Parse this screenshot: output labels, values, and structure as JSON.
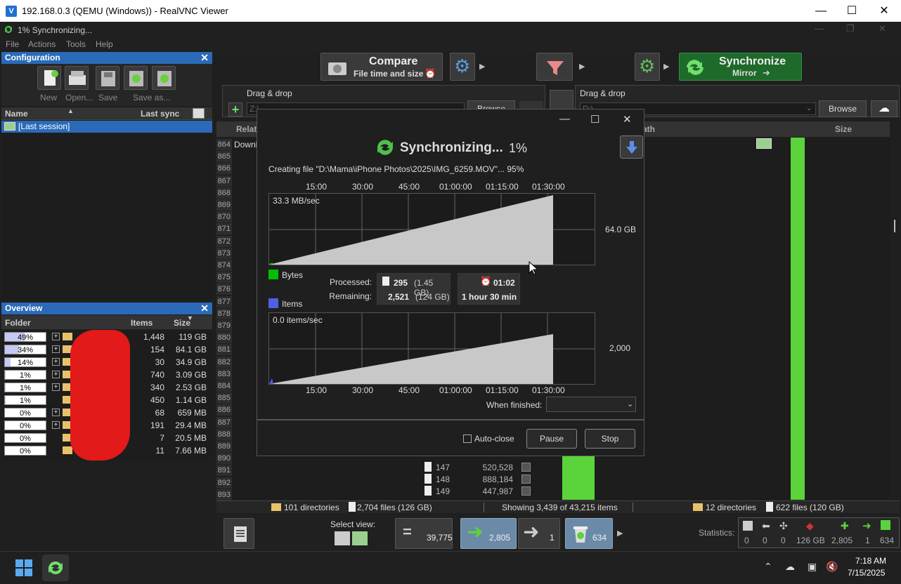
{
  "vnc": {
    "title": "192.168.0.3 (QEMU (Windows)) - RealVNC Viewer",
    "icon": "realvnc-icon",
    "minimize": "—",
    "maximize": "☐",
    "close": "✕"
  },
  "app": {
    "title": "1% Synchronizing...",
    "menu": [
      "File",
      "Actions",
      "Tools",
      "Help"
    ]
  },
  "config": {
    "header": "Configuration",
    "buttons": [
      "New",
      "Open...",
      "Save",
      "Save as..."
    ],
    "columns": {
      "name": "Name",
      "last_sync": "Last sync"
    },
    "session": "[Last session]"
  },
  "overview": {
    "header": "Overview",
    "columns": {
      "folder": "Folder",
      "items": "Items",
      "size": "Size"
    },
    "rows": [
      {
        "pct": "49%",
        "fill": 0.49,
        "items": "1,448",
        "size": "119 GB",
        "expand": true
      },
      {
        "pct": "34%",
        "fill": 0.34,
        "items": "154",
        "size": "84.1 GB",
        "expand": true
      },
      {
        "pct": "14%",
        "fill": 0.14,
        "items": "30",
        "size": "34.9 GB",
        "expand": true
      },
      {
        "pct": "1%",
        "fill": 0.01,
        "items": "740",
        "size": "3.09 GB",
        "expand": true
      },
      {
        "pct": "1%",
        "fill": 0.01,
        "items": "340",
        "size": "2.53 GB",
        "expand": true
      },
      {
        "pct": "1%",
        "fill": 0.01,
        "items": "450",
        "size": "1.14 GB",
        "expand": false
      },
      {
        "pct": "0%",
        "fill": 0.0,
        "items": "68",
        "size": "659 MB",
        "expand": true
      },
      {
        "pct": "0%",
        "fill": 0.0,
        "items": "191",
        "size": "29.4 MB",
        "expand": true
      },
      {
        "pct": "0%",
        "fill": 0.0,
        "items": "7",
        "size": "20.5 MB",
        "expand": false
      },
      {
        "pct": "0%",
        "fill": 0.0,
        "items": "11",
        "size": "7.66 MB",
        "expand": false
      }
    ]
  },
  "toolbar": {
    "compare": "Compare",
    "compare_sub": "File time and size",
    "synchronize": "Synchronize",
    "synchronize_sub": "Mirror"
  },
  "left_folder": {
    "label": "Drag & drop",
    "path": "Z:\\",
    "browse": "Browse"
  },
  "right_folder": {
    "label": "Drag & drop",
    "path": "D:\\",
    "browse": "Browse"
  },
  "grid": {
    "left_col": "Relat",
    "right_path_col": "ath",
    "size_col": "Size",
    "first_row_text": "Downl",
    "row_numbers": [
      "864",
      "865",
      "866",
      "867",
      "868",
      "869",
      "870",
      "871",
      "872",
      "873",
      "874",
      "875",
      "876",
      "877",
      "878",
      "879",
      "880",
      "881",
      "882",
      "883",
      "884",
      "885",
      "886",
      "887",
      "888",
      "889",
      "890",
      "891",
      "892",
      "893"
    ],
    "visible_rows": [
      {
        "num": "147",
        "size": "520,528"
      },
      {
        "num": "148",
        "size": "888,184"
      },
      {
        "num": "149",
        "size": "447,987"
      }
    ]
  },
  "status": {
    "left_dirs": "101 directories",
    "left_files": "2,704 files (126 GB)",
    "showing": "Showing 3,439 of 43,215 items",
    "right_dirs": "12 directories",
    "right_files": "622 files (120 GB)"
  },
  "bottom": {
    "select_view": "Select view:",
    "equal_count": "39,775",
    "create_count": "2,805",
    "update_count": "1",
    "delete_count": "634",
    "statistics_label": "Statistics:",
    "stats": [
      "0",
      "0",
      "0",
      "126 GB",
      "2,805",
      "1",
      "634"
    ]
  },
  "taskbar": {
    "time": "7:18 AM",
    "date": "7/15/2025"
  },
  "dialog": {
    "title": "Synchronizing...",
    "percent": "1%",
    "status": "Creating file \"D:\\Mama\\iPhone Photos\\2025\\IMG_6259.MOV\"... 95%",
    "time_ticks": [
      "15:00",
      "30:00",
      "45:00",
      "01:00:00",
      "01:15:00",
      "01:30:00"
    ],
    "bytes_rate": "33.3 MB/sec",
    "bytes_total": "64.0 GB",
    "items_rate": "0.0 items/sec",
    "items_total": "2,000",
    "legend_bytes": "Bytes",
    "legend_items": "Items",
    "processed_label": "Processed:",
    "remaining_label": "Remaining:",
    "processed_count": "295",
    "processed_size": "(1.45 GB)",
    "remaining_count": "2,521",
    "remaining_size": "(124 GB)",
    "elapsed": "01:02",
    "remaining_time": "1 hour 30 min",
    "when_finished": "When finished:",
    "autoclose": "Auto-close",
    "pause": "Pause",
    "stop": "Stop",
    "colors": {
      "bytes": "#00c000",
      "items": "#5060e0"
    }
  }
}
